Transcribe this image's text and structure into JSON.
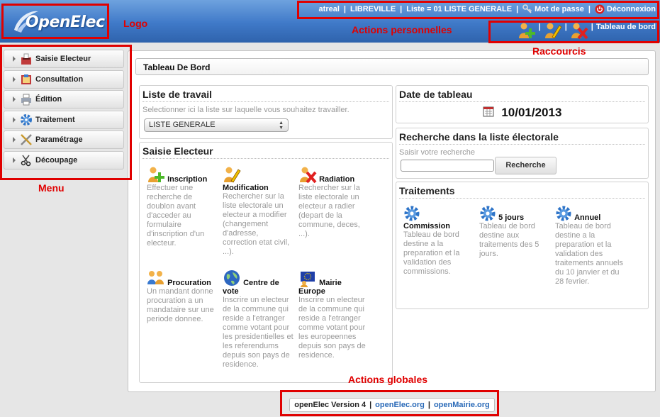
{
  "header": {
    "logo_text": "OpenElec",
    "user": "atreal",
    "city": "LIBREVILLE",
    "list": "Liste = 01 LISTE GENERALE",
    "password_link": "Mot de passe",
    "logout_link": "Déconnexion",
    "dashboard_label": "Tableau de bord",
    "shortcut_icons": [
      "add-elector-icon",
      "edit-elector-icon",
      "remove-elector-icon"
    ]
  },
  "annotations": {
    "logo": "Logo",
    "personal_actions": "Actions personnelles",
    "shortcuts": "Raccourcis",
    "menu": "Menu",
    "global_actions": "Actions globales"
  },
  "menu": {
    "items": [
      {
        "label": "Saisie Electeur",
        "icon": "ballot-box-icon"
      },
      {
        "label": "Consultation",
        "icon": "book-icon"
      },
      {
        "label": "Édition",
        "icon": "printer-icon"
      },
      {
        "label": "Traitement",
        "icon": "gear-icon"
      },
      {
        "label": "Paramétrage",
        "icon": "tools-icon"
      },
      {
        "label": "Découpage",
        "icon": "scissors-icon"
      }
    ]
  },
  "main": {
    "page_title": "Tableau De Bord",
    "worklist": {
      "title": "Liste de travail",
      "hint": "Selectionner ici la liste sur laquelle vous souhaitez travailler.",
      "selected": "LISTE GENERALE"
    },
    "saisie": {
      "title": "Saisie Electeur",
      "actions": [
        {
          "title": "Inscription",
          "desc": "Effectuer une recherche de doublon avant d'acceder au formulaire d'inscription d'un electeur."
        },
        {
          "title": "Modification",
          "desc": "Rechercher sur la liste electorale un electeur a modifier (changement d'adresse, correction etat civil, ...)."
        },
        {
          "title": "Radiation",
          "desc": "Rechercher sur la liste electorale un electeur a radier (depart de la commune, deces, ...)."
        },
        {
          "title": "Procuration",
          "desc": "Un mandant donne procuration a un mandataire sur une periode donnee."
        },
        {
          "title": "Centre de vote",
          "desc": "Inscrire un electeur de la commune qui reside a l'etranger comme votant pour les presidentielles et les referendums depuis son pays de residence."
        },
        {
          "title": "Mairie Europe",
          "desc": "Inscrire un electeur de la commune qui reside a l'etranger comme votant pour les europeennes depuis son pays de residence."
        }
      ]
    },
    "date_box": {
      "title": "Date de tableau",
      "date": "10/01/2013"
    },
    "search_box": {
      "title": "Recherche dans la liste électorale",
      "hint": "Saisir votre recherche",
      "input_value": "",
      "button": "Recherche"
    },
    "traitements": {
      "title": "Traitements",
      "items": [
        {
          "title": "Commission",
          "desc": "Tableau de bord destine a la preparation et la validation des commissions."
        },
        {
          "title": "5 jours",
          "desc": "Tableau de bord destine aux traitements des 5 jours."
        },
        {
          "title": "Annuel",
          "desc": "Tableau de bord destine a la preparation et la validation des traitements annuels du 10 janvier et du 28 fevrier."
        }
      ]
    }
  },
  "footer": {
    "version": "openElec Version 4",
    "link1": "openElec.org",
    "link2": "openMairie.org"
  }
}
